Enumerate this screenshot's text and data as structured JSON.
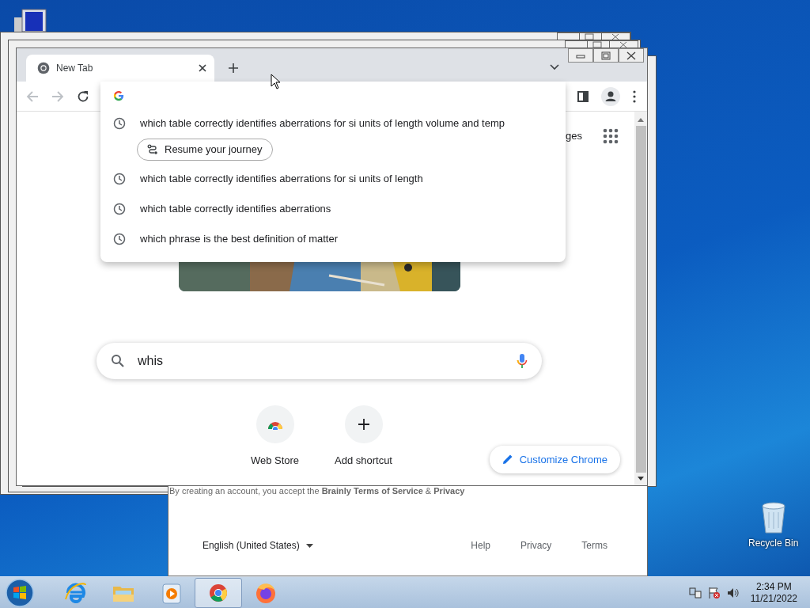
{
  "desktop": {
    "icons": [
      {
        "kind": "recycle",
        "label": "Recycle Bin"
      }
    ]
  },
  "browser": {
    "tabs": [
      {
        "title": "New Tab",
        "selected": true
      }
    ],
    "suggestions": [
      {
        "kind": "history",
        "text": "which table correctly identifies aberrations for si units of length volume and temp"
      },
      {
        "kind": "journey",
        "text": "Resume your journey"
      },
      {
        "kind": "history",
        "text": "which table correctly identifies aberrations for si units of length"
      },
      {
        "kind": "history",
        "text": "which table correctly identifies aberrations"
      },
      {
        "kind": "history",
        "text": "which phrase is the best definition of matter"
      }
    ],
    "partial_link": "ges",
    "search": {
      "value": "whis"
    },
    "shortcuts": [
      {
        "kind": "webstore",
        "label": "Web Store"
      },
      {
        "kind": "add",
        "label": "Add shortcut"
      }
    ],
    "customize_button": "Customize Chrome"
  },
  "background_page": {
    "notice": "By creating an account, you accept the **Brainly Terms of Service** & **Privacy**",
    "language": "English (United States)",
    "footer_links": [
      "Help",
      "Privacy",
      "Terms"
    ]
  },
  "taskbar": {
    "apps": [
      {
        "kind": "ie",
        "selected": false
      },
      {
        "kind": "explorer",
        "selected": false
      },
      {
        "kind": "media",
        "selected": false
      },
      {
        "kind": "chrome",
        "selected": true
      },
      {
        "kind": "firefox",
        "selected": false
      }
    ],
    "clock": {
      "time": "2:34 PM",
      "date": "11/21/2022"
    }
  }
}
